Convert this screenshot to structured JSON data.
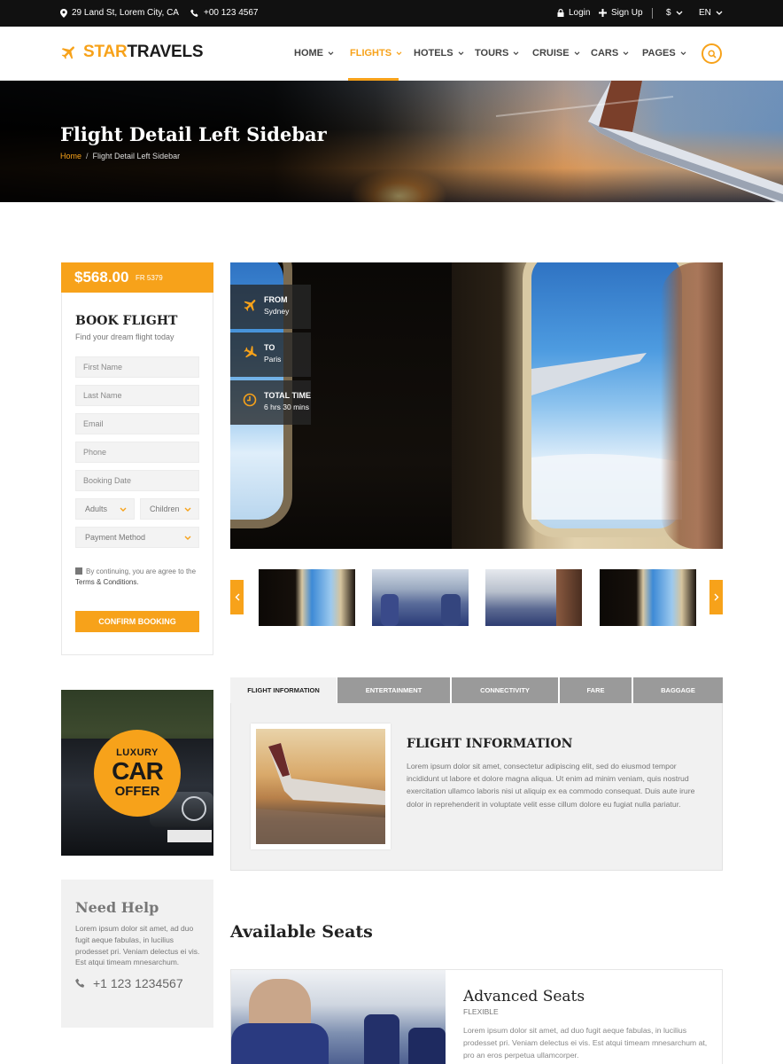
{
  "topbar": {
    "address": "29 Land St, Lorem City, CA",
    "phone": "+00 123 4567",
    "login": "Login",
    "signup": "Sign Up",
    "currency": "$",
    "language": "EN"
  },
  "brand": {
    "part1": "STAR",
    "part2": "TRAVELS"
  },
  "nav": {
    "items": [
      {
        "label": "HOME"
      },
      {
        "label": "FLIGHTS"
      },
      {
        "label": "HOTELS"
      },
      {
        "label": "TOURS"
      },
      {
        "label": "CRUISE"
      },
      {
        "label": "CARS"
      },
      {
        "label": "PAGES"
      }
    ],
    "active_index": 1
  },
  "hero": {
    "title": "Flight Detail Left Sidebar",
    "breadcrumb_home": "Home",
    "breadcrumb_sep": "/",
    "breadcrumb_current": "Flight Detail Left Sidebar"
  },
  "booking": {
    "price": "$568.00",
    "flight_code": "FR 5379",
    "title": "BOOK FLIGHT",
    "subtitle": "Find your dream flight today",
    "fields": {
      "first_name": "First Name",
      "last_name": "Last Name",
      "email": "Email",
      "phone": "Phone",
      "date": "Booking Date"
    },
    "adults": "Adults",
    "children": "Children",
    "payment": "Payment Method",
    "terms_prefix": "By continuing, you are agree to the",
    "terms_link": "Terms & Conditions.",
    "confirm": "CONFIRM BOOKING"
  },
  "flight_info": {
    "from_label": "FROM",
    "from_value": "Sydney",
    "to_label": "TO",
    "to_value": "Paris",
    "time_label": "TOTAL TIME",
    "time_value": "6 hrs 30 mins"
  },
  "ad": {
    "line1": "LUXURY",
    "line2": "CAR",
    "line3": "OFFER"
  },
  "help": {
    "title": "Need Help",
    "text": "Lorem ipsum dolor sit amet, ad duo fugit aeque fabulas, in lucilius prodesset pri. Veniam delectus ei vis. Est atqui timeam mnesarchum.",
    "phone": "+1 123 1234567"
  },
  "tabs": {
    "items": [
      {
        "label": "FLIGHT INFORMATION"
      },
      {
        "label": "ENTERTAINMENT"
      },
      {
        "label": "CONNECTIVITY"
      },
      {
        "label": "FARE"
      },
      {
        "label": "BAGGAGE"
      }
    ],
    "active_index": 0,
    "panel_title": "FLIGHT INFORMATION",
    "panel_text": "Lorem ipsum dolor sit amet, consectetur adipiscing elit, sed do eiusmod tempor incididunt ut labore et dolore magna aliqua. Ut enim ad minim veniam, quis nostrud exercitation ullamco laboris nisi ut aliquip ex ea commodo consequat. Duis aute irure dolor in reprehenderit in voluptate velit esse cillum dolore eu fugiat nulla pariatur."
  },
  "seats": {
    "section_title": "Available Seats",
    "card_title": "Advanced Seats",
    "card_type": "FLEXIBLE",
    "card_text": "Lorem ipsum dolor sit amet, ad duo fugit aeque fabulas, in lucilius prodesset pri. Veniam delectus ei vis. Est atqui timeam mnesarchum at, pro an eros perpetua ullamcorper."
  },
  "colors": {
    "accent": "#f7a21a",
    "dark": "#111111"
  }
}
